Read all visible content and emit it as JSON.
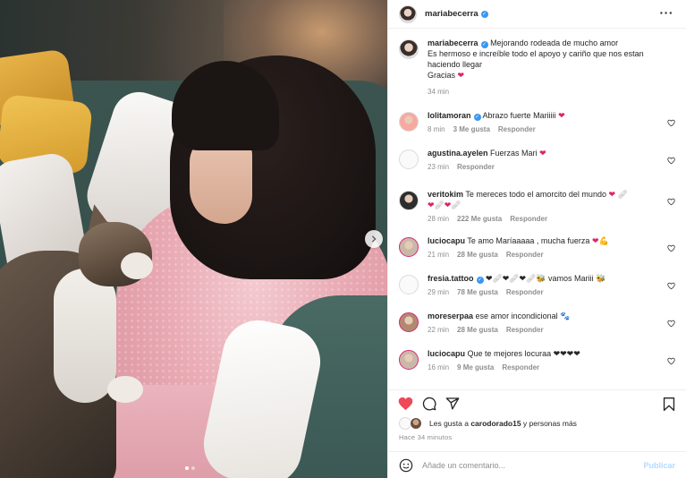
{
  "post": {
    "username": "mariabecerra",
    "caption_line1": "Mejorando rodeada de mucho amor",
    "caption_line2": "Es hermoso e increíble todo el apoyo y cariño que nos estan haciendo llegar",
    "caption_line3": "Gracias",
    "caption_time": "34 min"
  },
  "comments": [
    {
      "user": "lolitamoran",
      "verified": true,
      "text": "Abrazo fuerte Mariiiii",
      "emoji": "❤",
      "time": "8 min",
      "likes": "3 Me gusta",
      "reply": "Responder",
      "avatar_color": "#f7a9a0"
    },
    {
      "user": "agustina.ayelen",
      "verified": false,
      "text": "Fuerzas Mari",
      "emoji": "❤",
      "time": "23 min",
      "likes": "",
      "reply": "Responder",
      "avatar_color": "#fafafa"
    },
    {
      "user": "veritokim",
      "verified": false,
      "text": "Te mereces todo el amorcito del mundo",
      "emoji": "❤ 🩹",
      "text2": "❤🩹❤🩹",
      "time": "28 min",
      "likes": "222 Me gusta",
      "reply": "Responder",
      "avatar_color": "#2d2d2d"
    },
    {
      "user": "luciocapu",
      "verified": false,
      "text": "Te amo Maríaaaaa , mucha fuerza",
      "emoji": "❤💪",
      "time": "21 min",
      "likes": "28 Me gusta",
      "reply": "Responder",
      "avatar_color": "#c9b8a8"
    },
    {
      "user": "fresia.tattoo",
      "verified": true,
      "text": "❤🩹❤🩹❤🩹🐝 vamos Mariii 🐝",
      "emoji": "",
      "time": "29 min",
      "likes": "78 Me gusta",
      "reply": "Responder",
      "avatar_color": "#fafafa"
    },
    {
      "user": "moreserpaa",
      "verified": false,
      "text": "ese amor incondicional",
      "emoji": "🐾",
      "time": "22 min",
      "likes": "28 Me gusta",
      "reply": "Responder",
      "avatar_color": "#b08a6e"
    },
    {
      "user": "luciocapu",
      "verified": false,
      "text": "Que te mejores locuraa ❤❤❤❤",
      "emoji": "",
      "time": "16 min",
      "likes": "9 Me gusta",
      "reply": "Responder",
      "avatar_color": "#c9b8a8"
    }
  ],
  "likes_line": {
    "prefix": "Les gusta a",
    "user": "carodorado15",
    "suffix": "y personas más"
  },
  "timestamp": "Hace 34 minutos",
  "add_comment": {
    "placeholder": "Añade un comentario...",
    "publish": "Publicar"
  },
  "icons": {
    "like": "heart-filled-icon",
    "comment": "comment-icon",
    "share": "share-icon",
    "save": "bookmark-icon",
    "emoji": "emoji-icon",
    "more": "more-icon",
    "next": "chevron-right-icon"
  },
  "colors": {
    "like_red": "#ed4956",
    "verified_blue": "#3897f0",
    "publish_disabled": "#b3dbff",
    "meta_gray": "#8e8e8e"
  }
}
